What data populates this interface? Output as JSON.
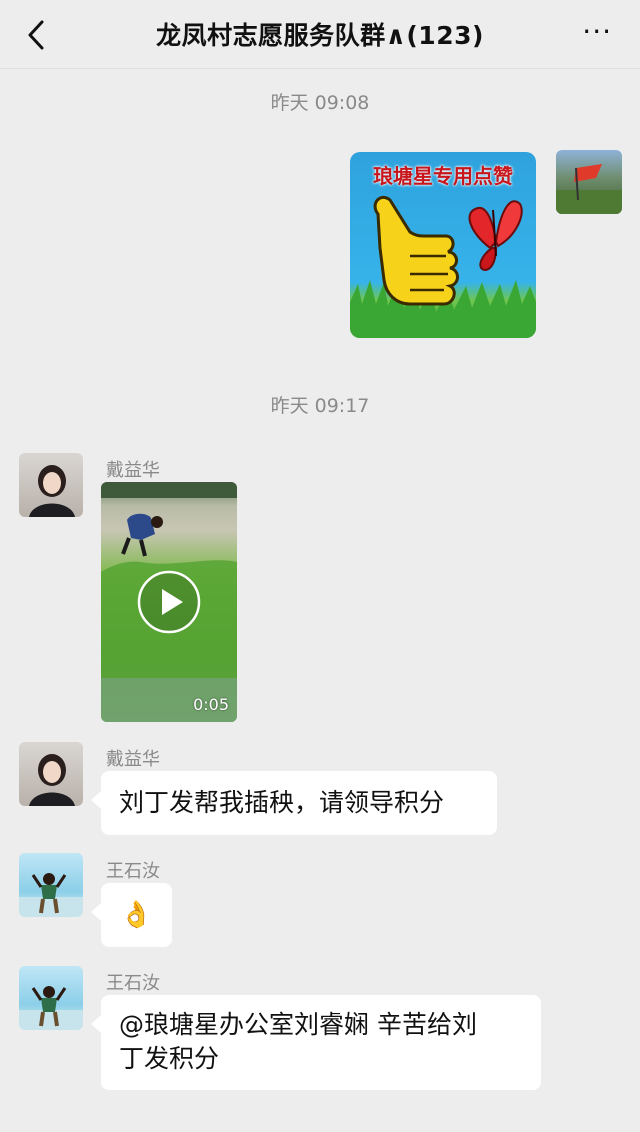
{
  "header": {
    "title": "龙凤村志愿服务队群∧(123)",
    "more_label": "···"
  },
  "timestamps": [
    "昨天 09:08",
    "昨天 09:17"
  ],
  "sticker": {
    "caption": "琅塘星专用点赞"
  },
  "messages": [
    {
      "sender": "戴益华",
      "type": "video",
      "duration": "0:05"
    },
    {
      "sender": "戴益华",
      "type": "text",
      "text": "刘丁发帮我插秧，请领导积分"
    },
    {
      "sender": "王石汝",
      "type": "emoji",
      "text": "👌"
    },
    {
      "sender": "王石汝",
      "type": "text",
      "text_line1": "@琅塘星办公室刘睿娴  辛苦给刘",
      "text_line2": "丁发积分"
    }
  ],
  "colors": {
    "background": "#ededed",
    "bubble": "#ffffff",
    "meta_text": "#8a8a8a"
  }
}
